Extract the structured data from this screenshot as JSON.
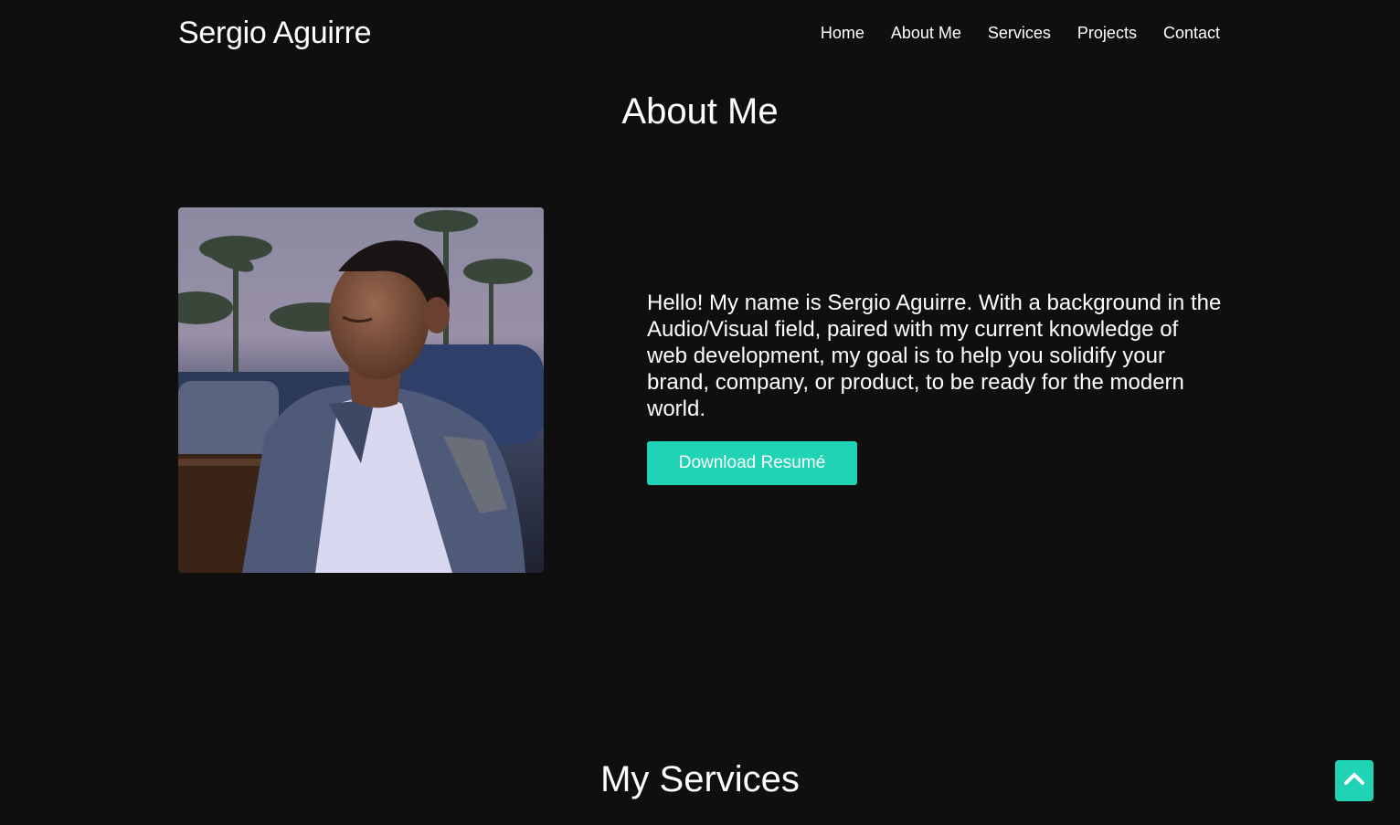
{
  "header": {
    "brand": "Sergio Aguirre",
    "nav": [
      "Home",
      "About Me",
      "Services",
      "Projects",
      "Contact"
    ]
  },
  "about": {
    "title": "About Me",
    "photo_icon": "profile-photo",
    "bio": "Hello! My name is Sergio Aguirre. With a background in the Audio/Visual field, paired with my current knowledge of web development, my goal is to help you solidify your brand, company, or product, to be ready for the modern world.",
    "resume_button": "Download Resumé"
  },
  "services": {
    "title": "My Services"
  },
  "scroll_top": {
    "icon": "chevron-up-icon"
  },
  "colors": {
    "background": "#0f0f0f",
    "accent": "#1fd3b4",
    "text": "#ffffff"
  }
}
